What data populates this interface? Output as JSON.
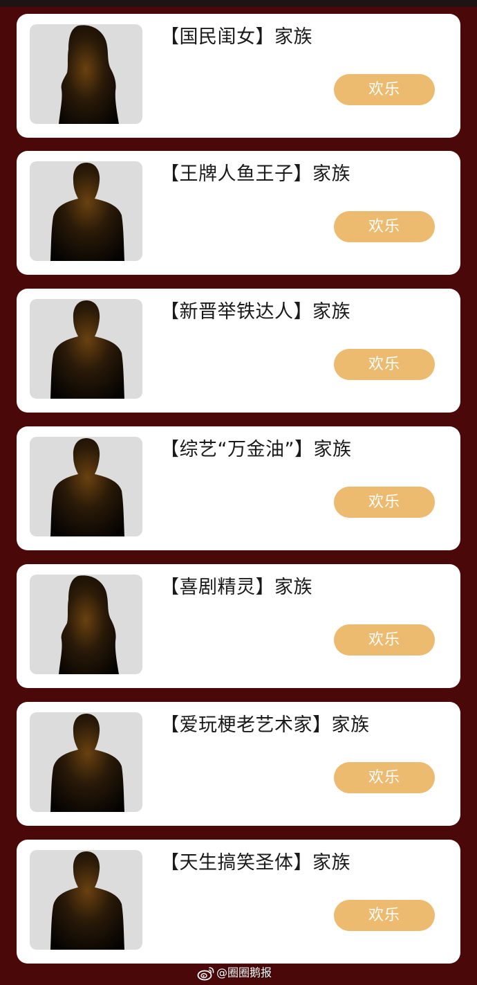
{
  "families": [
    {
      "title": "【国民闺女】家族",
      "button_label": "欢乐",
      "avatar": "female-silhouette"
    },
    {
      "title": "【王牌人鱼王子】家族",
      "button_label": "欢乐",
      "avatar": "male-silhouette"
    },
    {
      "title": "【新晋举铁达人】家族",
      "button_label": "欢乐",
      "avatar": "male-silhouette"
    },
    {
      "title": "【综艺“万金油”】家族",
      "button_label": "欢乐",
      "avatar": "male-silhouette"
    },
    {
      "title": "【喜剧精灵】家族",
      "button_label": "欢乐",
      "avatar": "female-silhouette"
    },
    {
      "title": "【爱玩梗老艺术家】家族",
      "button_label": "欢乐",
      "avatar": "male-silhouette"
    },
    {
      "title": "【天生搞笑圣体】家族",
      "button_label": "欢乐",
      "avatar": "male-silhouette"
    }
  ],
  "watermark": {
    "text": "@圈圈鹅报",
    "icon": "weibo-logo"
  },
  "colors": {
    "background": "#4a0808",
    "card": "#ffffff",
    "button": "#ecbb6f",
    "button_text": "#ffffff",
    "avatar_bg": "#dcdcdc"
  }
}
